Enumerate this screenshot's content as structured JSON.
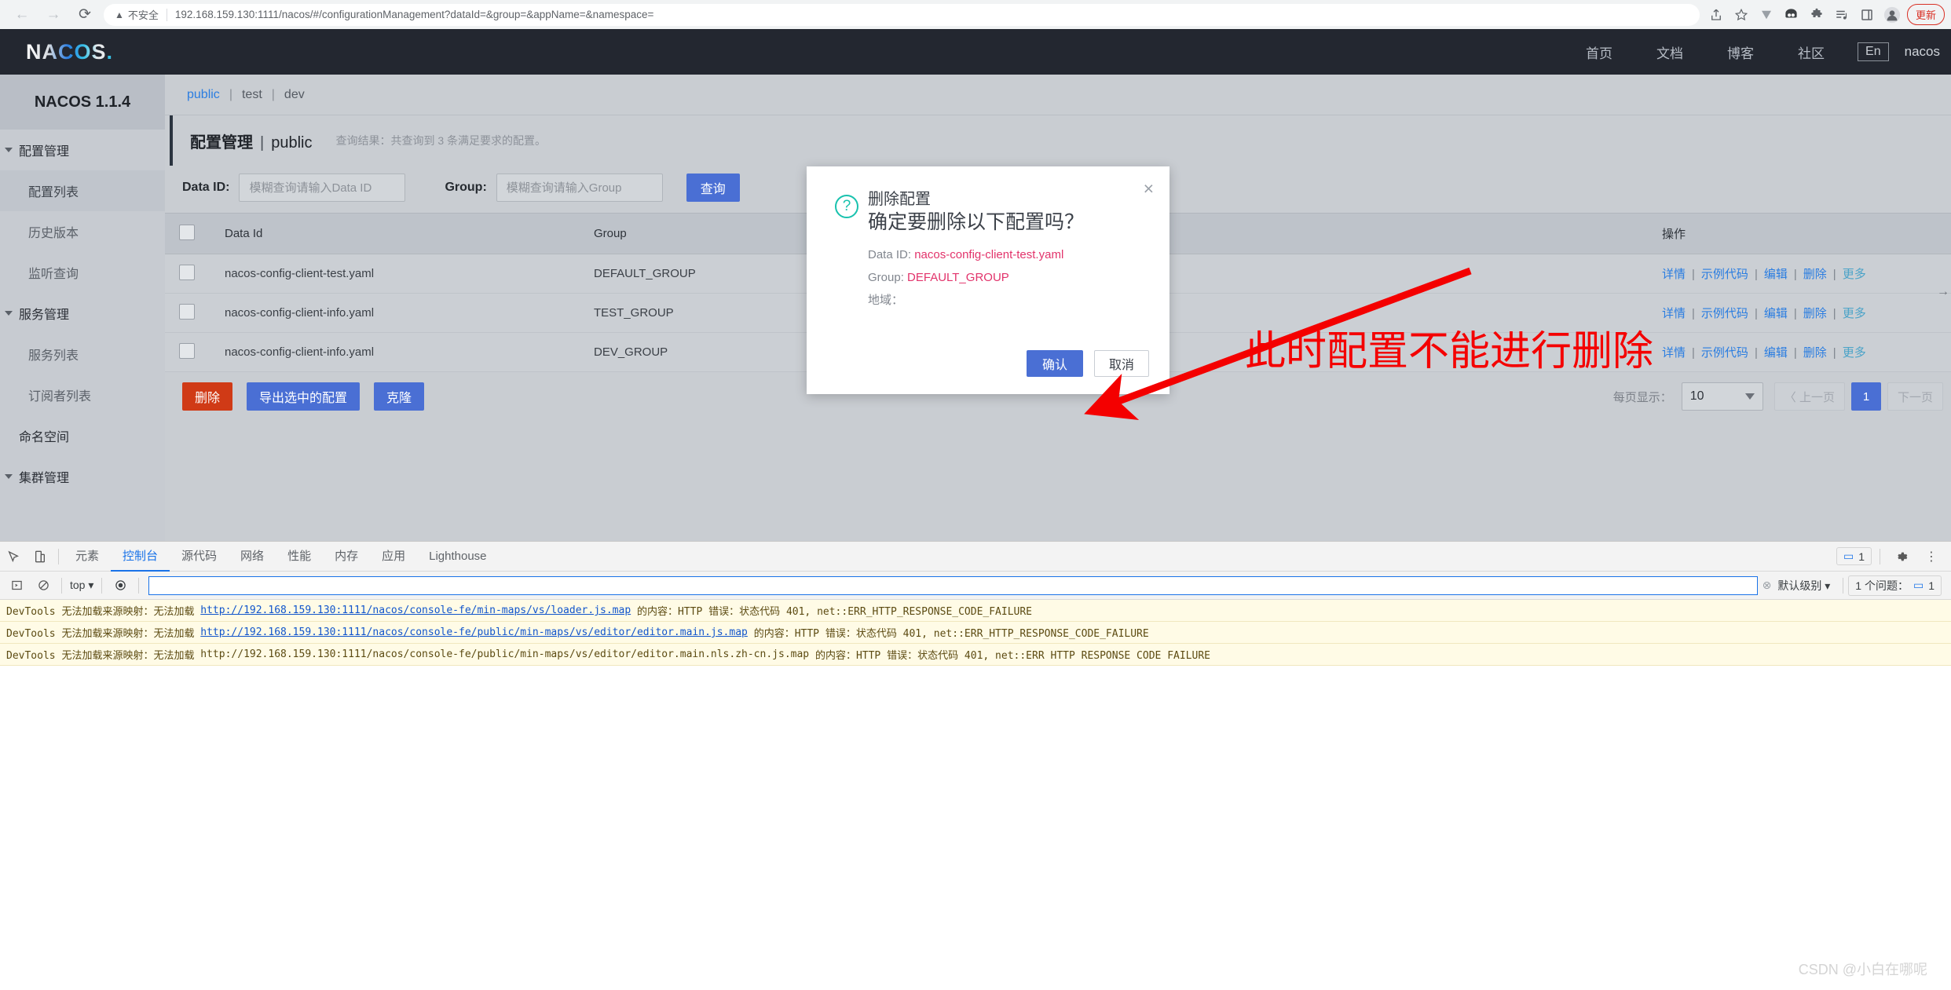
{
  "browser": {
    "back_icon": "back-arrow",
    "forward_icon": "forward-arrow",
    "reload_icon": "reload",
    "security_icon": "warning-triangle",
    "security_label": "不安全",
    "url_host": "192.168.159.130:1111",
    "url_path": "/nacos/#/configurationManagement?dataId=&group=&appName=&namespace=",
    "url_full": "192.168.159.130:1111/nacos/#/configurationManagement?dataId=&group=&appName=&namespace=",
    "toolbar_icons": [
      "share-icon",
      "star-icon",
      "download-icon",
      "extension-panda-icon",
      "puzzle-icon",
      "playlist-icon",
      "sidepanel-icon",
      "profile-avatar-icon"
    ],
    "update_label": "更新"
  },
  "topbar": {
    "logo": "NACOS",
    "logo_dot": ".",
    "nav": [
      {
        "label": "首页",
        "name": "nav-home"
      },
      {
        "label": "文档",
        "name": "nav-docs"
      },
      {
        "label": "博客",
        "name": "nav-blog"
      },
      {
        "label": "社区",
        "name": "nav-community"
      }
    ],
    "lang": "En",
    "user": "nacos"
  },
  "sidebar": {
    "title": "NACOS 1.1.4",
    "items": [
      {
        "label": "配置管理",
        "type": "group",
        "active": false
      },
      {
        "label": "配置列表",
        "type": "child",
        "active": true
      },
      {
        "label": "历史版本",
        "type": "child",
        "active": false
      },
      {
        "label": "监听查询",
        "type": "child",
        "active": false
      },
      {
        "label": "服务管理",
        "type": "group",
        "active": false
      },
      {
        "label": "服务列表",
        "type": "child",
        "active": false
      },
      {
        "label": "订阅者列表",
        "type": "child",
        "active": false
      },
      {
        "label": "命名空间",
        "type": "plain",
        "active": false
      },
      {
        "label": "集群管理",
        "type": "group",
        "active": false
      }
    ]
  },
  "namespace_tabs": {
    "items": [
      "public",
      "test",
      "dev"
    ],
    "active": "public"
  },
  "page": {
    "title": "配置管理",
    "separator": "|",
    "namespace": "public",
    "result_note": "查询结果：共查询到 3 条满足要求的配置。"
  },
  "search": {
    "dataid_label": "Data ID:",
    "dataid_placeholder": "模糊查询请输入Data ID",
    "dataid_value": "",
    "group_label": "Group:",
    "group_placeholder": "模糊查询请输入Group",
    "group_value": "",
    "submit_label": "查询"
  },
  "table": {
    "headers": [
      "",
      "Data Id",
      "Group",
      "",
      "",
      "操作"
    ],
    "header_dataid": "Data Id",
    "header_group": "Group",
    "header_op": "操作",
    "rows": [
      {
        "data_id": "nacos-config-client-test.yaml",
        "group": "DEFAULT_GROUP"
      },
      {
        "data_id": "nacos-config-client-info.yaml",
        "group": "TEST_GROUP"
      },
      {
        "data_id": "nacos-config-client-info.yaml",
        "group": "DEV_GROUP"
      }
    ],
    "ops": [
      "详情",
      "示例代码",
      "编辑",
      "删除",
      "更多"
    ],
    "op_divider": "|"
  },
  "actions": {
    "delete": "删除",
    "export_selected": "导出选中的配置",
    "clone": "克隆"
  },
  "pagination": {
    "page_size_label": "每页显示：",
    "page_size": "10",
    "prev": "上一页",
    "prev_glyph": "〈",
    "current_page": "1",
    "next": "下一页"
  },
  "modal": {
    "icon": "question-mark-circle-icon",
    "close": "×",
    "title": "删除配置",
    "question": "确定要删除以下配置吗？",
    "dataid_label": "Data ID:",
    "dataid_value": "nacos-config-client-test.yaml",
    "group_label": "Group:",
    "group_value": "DEFAULT_GROUP",
    "region_label": "地域：",
    "region_value": "",
    "confirm": "确认",
    "cancel": "取消"
  },
  "annotation": {
    "text": "此时配置不能进行删除",
    "color": "#f40000"
  },
  "devtools": {
    "tabs": [
      {
        "label": "元素",
        "active": false
      },
      {
        "label": "控制台",
        "active": true
      },
      {
        "label": "源代码",
        "active": false
      },
      {
        "label": "网络",
        "active": false
      },
      {
        "label": "性能",
        "active": false
      },
      {
        "label": "内存",
        "active": false
      },
      {
        "label": "应用",
        "active": false
      },
      {
        "label": "Lighthouse",
        "active": false
      }
    ],
    "inspect_icon": "inspect-cursor-icon",
    "device_icon": "device-toolbar-icon",
    "settings_icon": "gear-icon",
    "more_icon": "kebab-menu-icon",
    "issue_count": "1",
    "toolbar": {
      "clear_icon": "clear-console-icon",
      "context": "top",
      "eye_icon": "live-expression-eye-icon",
      "input_value": "",
      "level_label": "默认级别",
      "issues_label": "1 个问题：",
      "issues_count": "1"
    },
    "messages": [
      {
        "prefix": "DevTools 无法加载来源映射：无法加载",
        "url": "http://192.168.159.130:1111/nacos/console-fe/min-maps/vs/loader.js.map",
        "suffix": "的内容：HTTP 错误：状态代码 401, net::ERR_HTTP_RESPONSE_CODE_FAILURE"
      },
      {
        "prefix": "DevTools 无法加载来源映射：无法加载",
        "url": "http://192.168.159.130:1111/nacos/console-fe/public/min-maps/vs/editor/editor.main.js.map",
        "suffix": "的内容：HTTP 错误：状态代码 401, net::ERR_HTTP_RESPONSE_CODE_FAILURE"
      },
      {
        "prefix": "DevTools 无法加载来源映射：无法加载",
        "url": "http://192.168.159.130:1111/nacos/console-fe/public/min-maps/vs/editor/editor.main.nls.zh-cn.js.map",
        "suffix": "的内容：HTTP 错误：状态代码 401, net::ERR HTTP RESPONSE CODE FAILURE"
      }
    ]
  },
  "watermark": "CSDN @小白在哪呢"
}
